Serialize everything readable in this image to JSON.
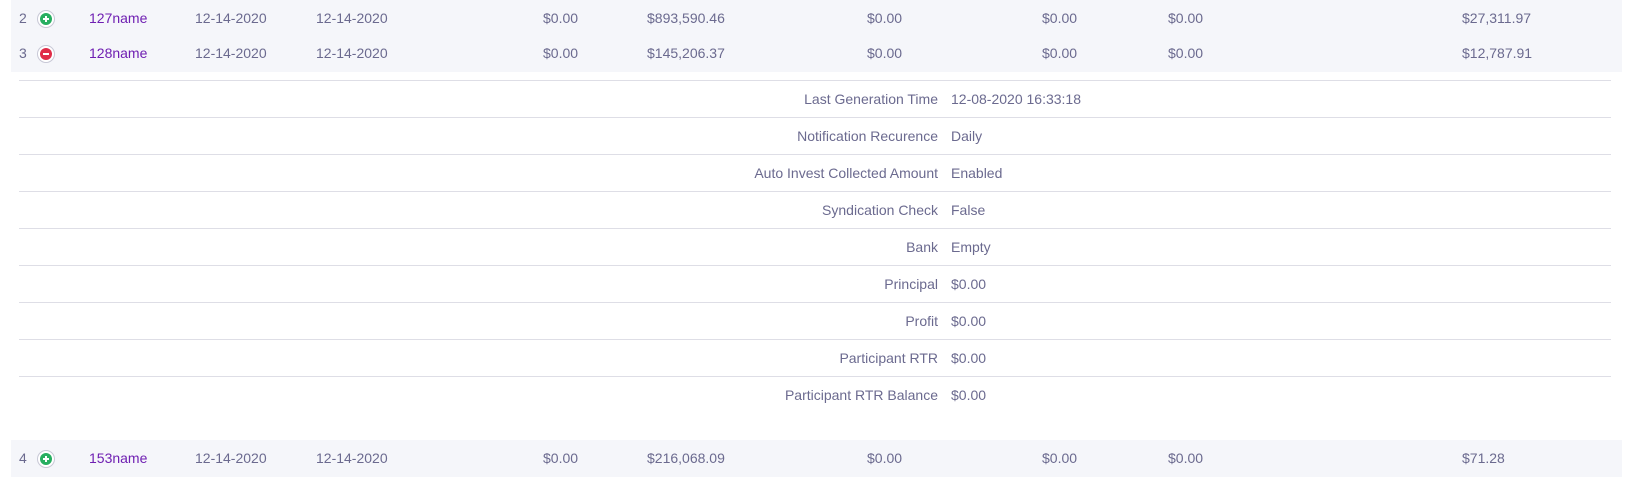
{
  "rows": [
    {
      "num": "2",
      "toggle": "expand",
      "name": "127name",
      "date1": "12-14-2020",
      "date2": "12-14-2020",
      "v1": "$0.00",
      "v2": "$893,590.46",
      "v3": "$0.00",
      "v4": "$0.00",
      "v5": "$0.00",
      "v6": "$27,311.97"
    },
    {
      "num": "3",
      "toggle": "collapse",
      "name": "128name",
      "date1": "12-14-2020",
      "date2": "12-14-2020",
      "v1": "$0.00",
      "v2": "$145,206.37",
      "v3": "$0.00",
      "v4": "$0.00",
      "v5": "$0.00",
      "v6": "$12,787.91"
    },
    {
      "num": "4",
      "toggle": "expand",
      "name": "153name",
      "date1": "12-14-2020",
      "date2": "12-14-2020",
      "v1": "$0.00",
      "v2": "$216,068.09",
      "v3": "$0.00",
      "v4": "$0.00",
      "v5": "$0.00",
      "v6": "$71.28"
    }
  ],
  "details": [
    {
      "label": "Last Generation Time",
      "value": "12-08-2020 16:33:18"
    },
    {
      "label": "Notification Recurence",
      "value": "Daily"
    },
    {
      "label": "Auto Invest Collected Amount",
      "value": "Enabled"
    },
    {
      "label": "Syndication Check",
      "value": "False"
    },
    {
      "label": "Bank",
      "value": "Empty"
    },
    {
      "label": "Principal",
      "value": "$0.00"
    },
    {
      "label": "Profit",
      "value": "$0.00"
    },
    {
      "label": "Participant RTR",
      "value": "$0.00"
    },
    {
      "label": "Participant RTR Balance",
      "value": "$0.00"
    }
  ],
  "colors": {
    "row_bg": "#f5f6fa",
    "text": "#6b6a8f",
    "name_link": "#6f1fb2",
    "expand": "#27ae60",
    "collapse": "#e02c48",
    "divider": "#dedee6"
  },
  "icons": {
    "expand": "plus-circle-icon",
    "collapse": "minus-circle-icon"
  }
}
